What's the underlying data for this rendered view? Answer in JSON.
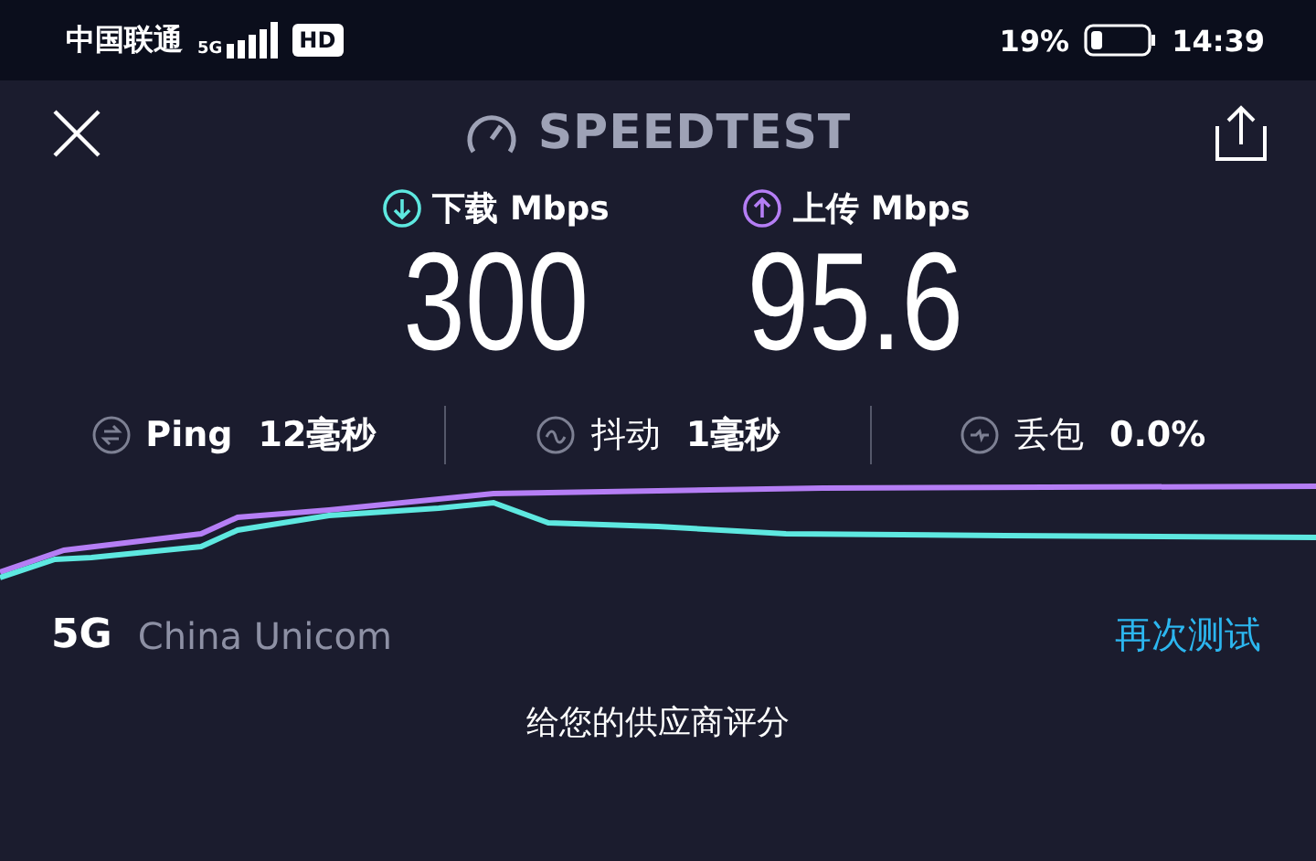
{
  "status_bar": {
    "carrier": "中国联通",
    "network": "5G",
    "hd_badge": "HD",
    "battery": "19%",
    "time": "14:39"
  },
  "header": {
    "title": "SPEEDTEST"
  },
  "results": [
    {
      "kind": "download",
      "label": "下载 Mbps",
      "value": "300"
    },
    {
      "kind": "upload",
      "label": "上传 Mbps",
      "value": "95.6"
    }
  ],
  "stats": [
    {
      "kind": "ping",
      "label": "Ping",
      "value": "12毫秒"
    },
    {
      "kind": "jitter",
      "label": "抖动",
      "value": "1毫秒"
    },
    {
      "kind": "loss",
      "label": "丢包",
      "value": "0.0%"
    }
  ],
  "provider": {
    "network": "5G",
    "name": "China Unicom",
    "retest": "再次测试"
  },
  "rate_prompt": "给您的供应商评分"
}
